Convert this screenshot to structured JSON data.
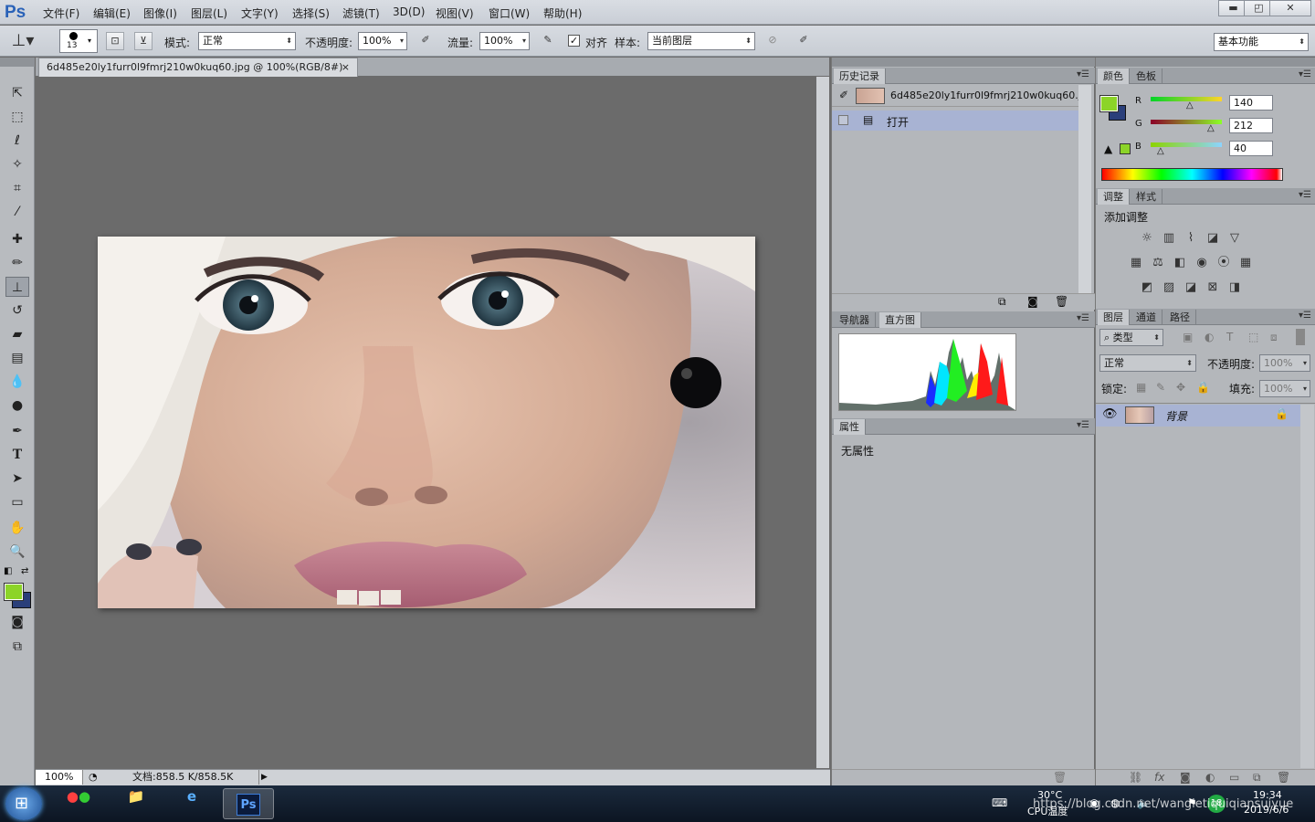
{
  "app": {
    "logo": "Ps",
    "workspace": "基本功能"
  },
  "menu": [
    "文件(F)",
    "编辑(E)",
    "图像(I)",
    "图层(L)",
    "文字(Y)",
    "选择(S)",
    "滤镜(T)",
    "3D(D)",
    "视图(V)",
    "窗口(W)",
    "帮助(H)"
  ],
  "window_buttons": {
    "minimize": "▬",
    "restore": "◰",
    "close": "✕"
  },
  "options": {
    "brush_size": "13",
    "mode_label": "模式:",
    "mode_value": "正常",
    "opacity_label": "不透明度:",
    "opacity_value": "100%",
    "flow_label": "流量:",
    "flow_value": "100%",
    "align_label": "对齐",
    "sample_label": "样本:",
    "sample_value": "当前图层"
  },
  "document": {
    "tab_title": "6d485e20ly1furr0l9fmrj210w0kuq60.jpg @ 100%(RGB/8#)",
    "tab_close": "×",
    "zoom": "100%",
    "doc_info": "文档:858.5 K/858.5K"
  },
  "history": {
    "tab": "历史记录",
    "snapshot_name": "6d485e20ly1furr0l9fmrj210w0kuq60.j...",
    "steps": [
      "打开"
    ]
  },
  "navigator": {
    "tabs": [
      "导航器",
      "直方图"
    ],
    "active": "直方图"
  },
  "properties": {
    "tab": "属性",
    "text": "无属性"
  },
  "color": {
    "tabs": [
      "颜色",
      "色板"
    ],
    "labels": {
      "r": "R",
      "g": "G",
      "b": "B"
    },
    "r": 140,
    "g": 212,
    "b": 40,
    "fg": "#8cd428",
    "bg": "#2a3f7a"
  },
  "adjustments": {
    "tabs": [
      "调整",
      "样式"
    ],
    "title": "添加调整"
  },
  "layers": {
    "tabs": [
      "图层",
      "通道",
      "路径"
    ],
    "filter_label": "类型",
    "blend": "正常",
    "opacity_label": "不透明度:",
    "opacity": "100%",
    "lock_label": "锁定:",
    "fill_label": "填充:",
    "fill": "100%",
    "layer_name": "背景"
  },
  "taskbar": {
    "temp": "30°C",
    "cpu_label": "CPU温度",
    "time": "19:34",
    "date": "2019/6/6",
    "badge": "18",
    "ps_label": "Ps"
  },
  "watermark": "https://blog.csdn.net/wangletiquiqiansuiyue"
}
